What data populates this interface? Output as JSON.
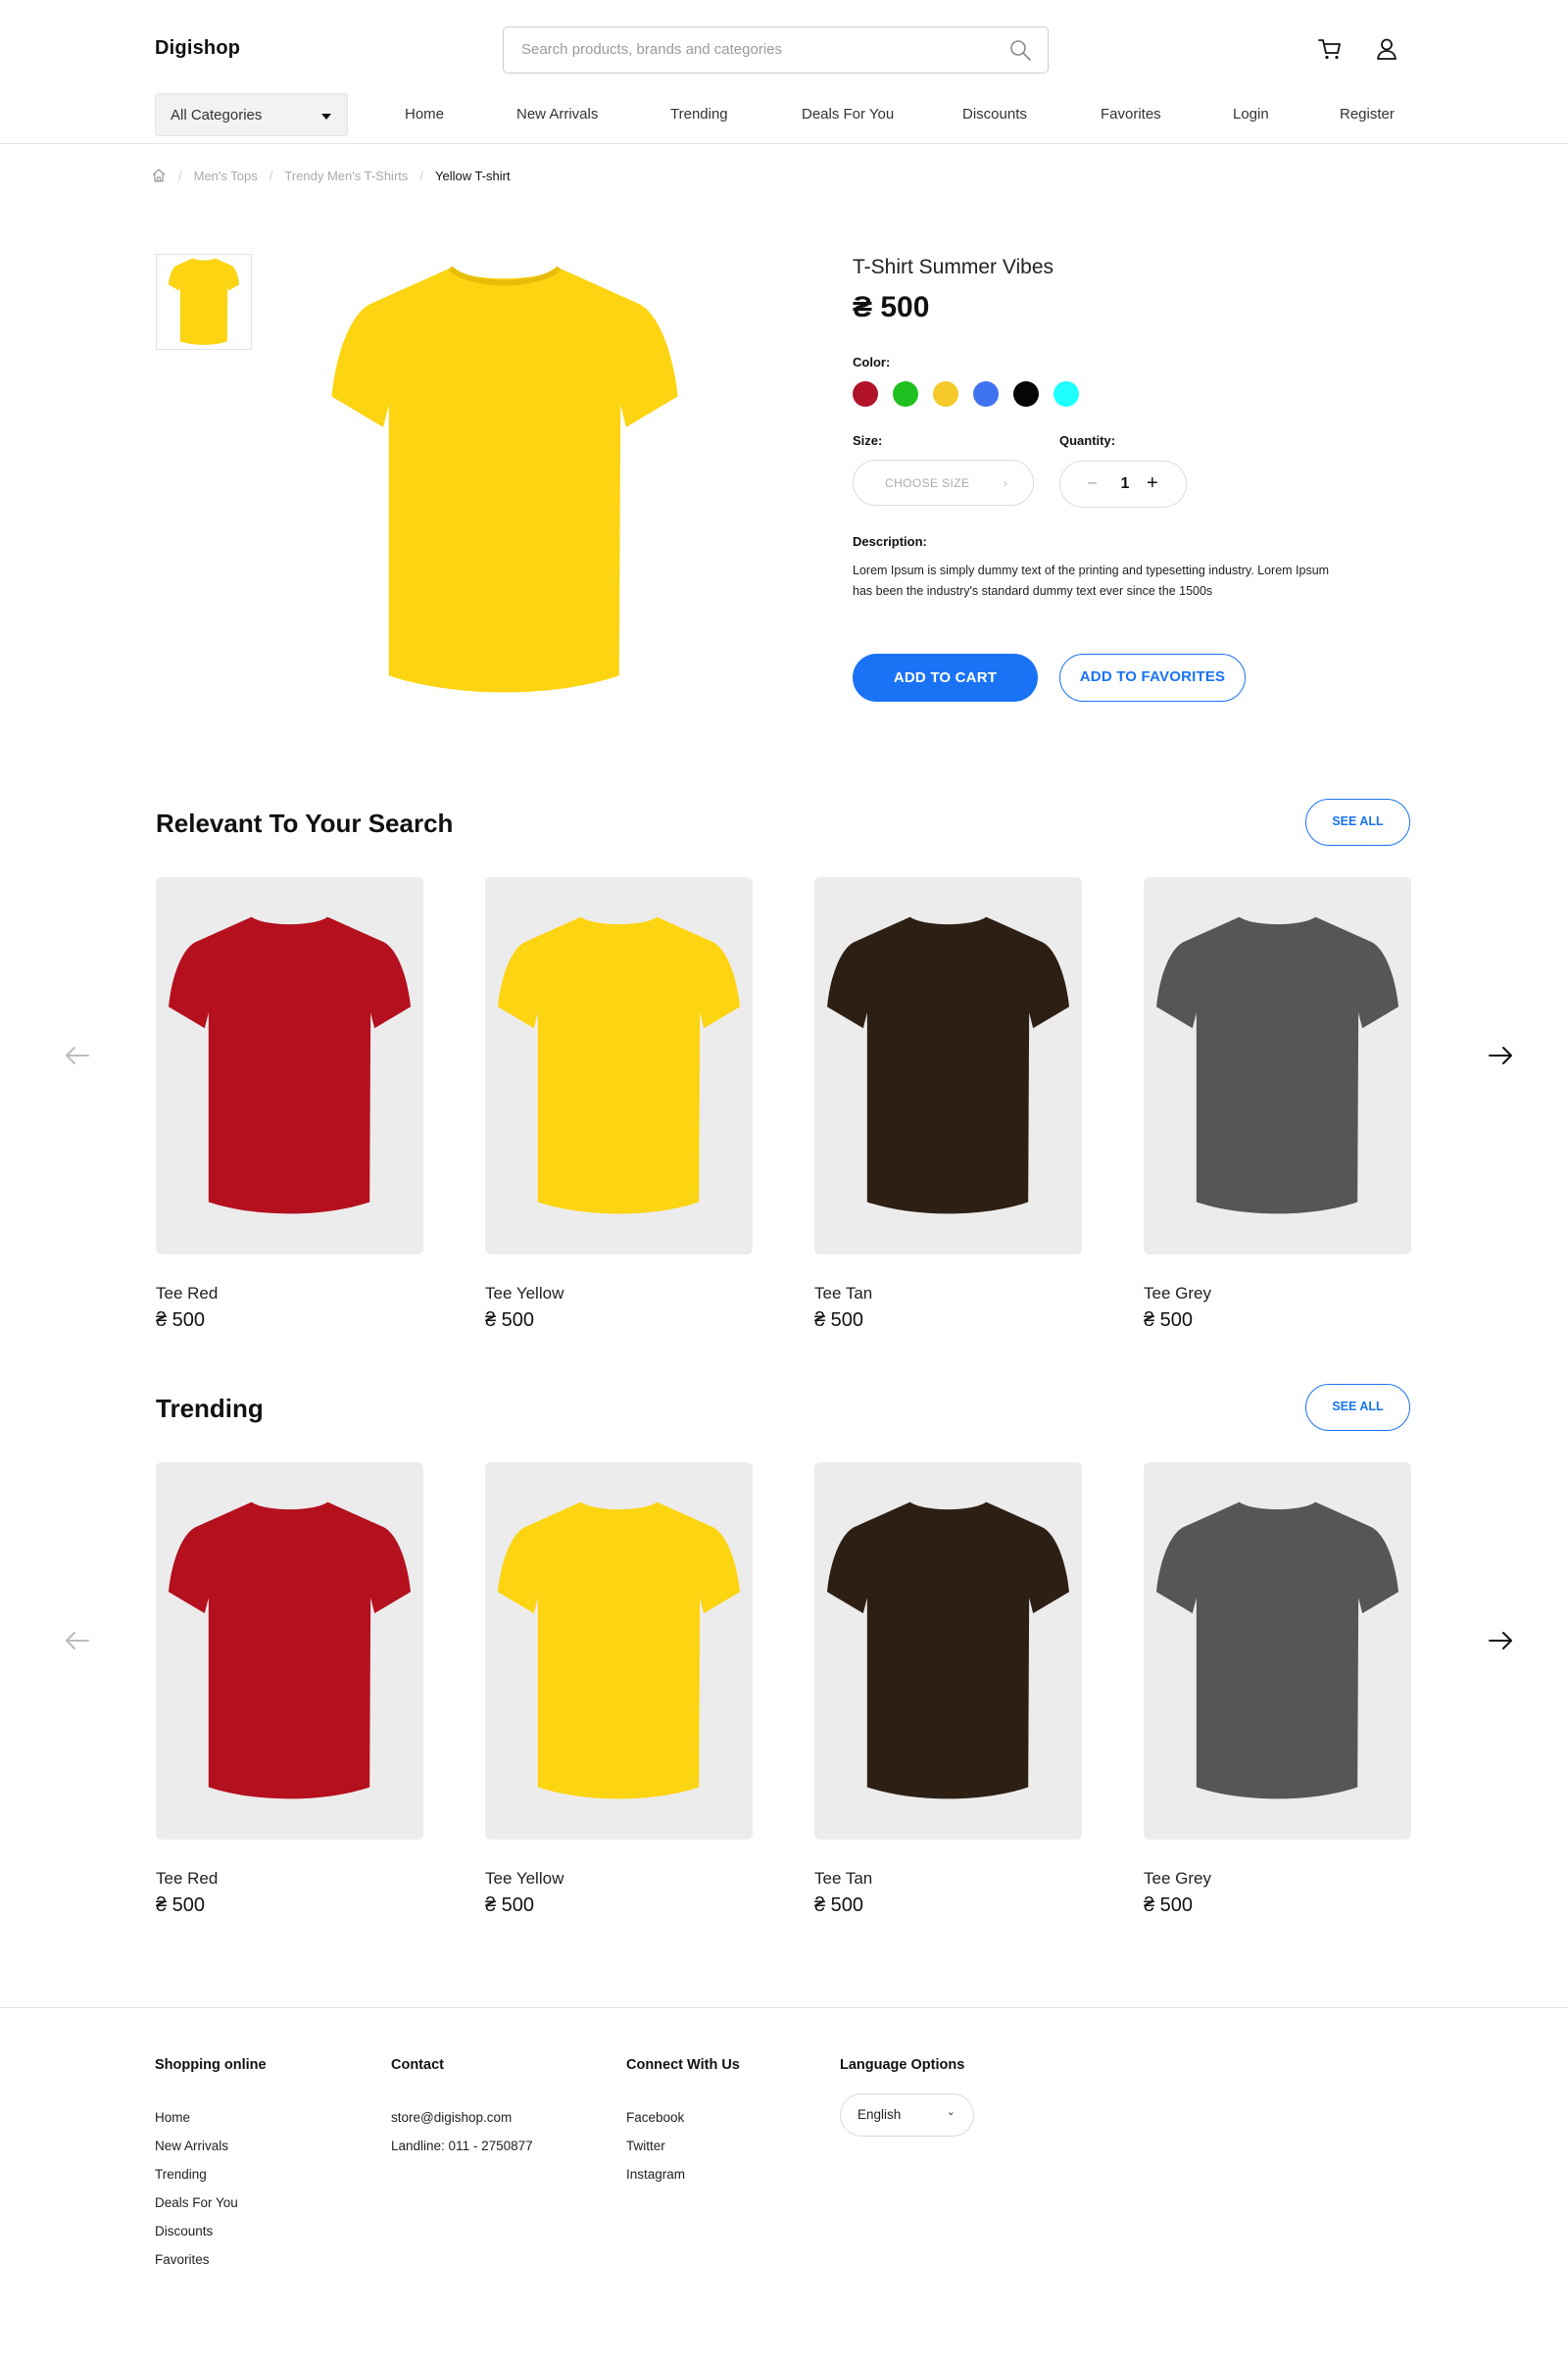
{
  "header": {
    "logo": "Digishop",
    "search_placeholder": "Search products, brands and categories",
    "icons": [
      "cart-icon",
      "user-icon",
      "search-icon"
    ]
  },
  "nav": {
    "category_select": "All Categories",
    "links": [
      "Home",
      "New Arrivals",
      "Trending",
      "Deals For You",
      "Discounts",
      "Favorites",
      "Login",
      "Register"
    ]
  },
  "breadcrumb": {
    "items": [
      "Men's Tops",
      "Trendy Men's T-Shirts",
      "Yellow T-shirt"
    ]
  },
  "product": {
    "name": "T-Shirt Summer Vibes",
    "price": "₴ 500",
    "color_label": "Color:",
    "colors": [
      "#b0132a",
      "#1fbf1f",
      "#f6c92a",
      "#3f73f0",
      "#050505",
      "#20ffff"
    ],
    "size_label": "Size:",
    "size_placeholder": "CHOOSE SIZE",
    "quantity_label": "Quantity:",
    "quantity_value": "1",
    "description_label": "Description:",
    "description": "Lorem Ipsum is simply dummy text of the printing and typesetting industry. Lorem Ipsum has been the industry's standard dummy text ever since the 1500s",
    "add_to_cart": "ADD TO CART",
    "add_to_favorites": "ADD TO FAVORITES",
    "main_color": "#fcd412"
  },
  "relevant": {
    "title": "Relevant To Your Search",
    "see_all": "SEE ALL",
    "items": [
      {
        "name": "Tee Red",
        "price": "₴ 500",
        "color": "#b4101e"
      },
      {
        "name": "Tee Yellow",
        "price": "₴ 500",
        "color": "#fcd412"
      },
      {
        "name": "Tee Tan",
        "price": "₴ 500",
        "color": "#2e1f14"
      },
      {
        "name": "Tee Grey",
        "price": "₴ 500",
        "color": "#565656"
      }
    ]
  },
  "trending": {
    "title": "Trending",
    "see_all": "SEE ALL",
    "items": [
      {
        "name": "Tee Red",
        "price": "₴ 500",
        "color": "#b4101e"
      },
      {
        "name": "Tee Yellow",
        "price": "₴ 500",
        "color": "#fcd412"
      },
      {
        "name": "Tee Tan",
        "price": "₴ 500",
        "color": "#2e1f14"
      },
      {
        "name": "Tee Grey",
        "price": "₴ 500",
        "color": "#565656"
      }
    ]
  },
  "footer": {
    "shopping": {
      "title": "Shopping online",
      "links": [
        "Home",
        "New Arrivals",
        "Trending",
        "Deals For You",
        "Discounts",
        "Favorites"
      ]
    },
    "contact": {
      "title": "Contact",
      "lines": [
        "store@digishop.com",
        "Landline: 011 - 2750877"
      ]
    },
    "connect": {
      "title": "Connect With Us",
      "links": [
        "Facebook",
        "Twitter",
        "Instagram"
      ]
    },
    "language": {
      "title": "Language Options",
      "selected": "English"
    }
  },
  "accent_color": "#1a73f5"
}
